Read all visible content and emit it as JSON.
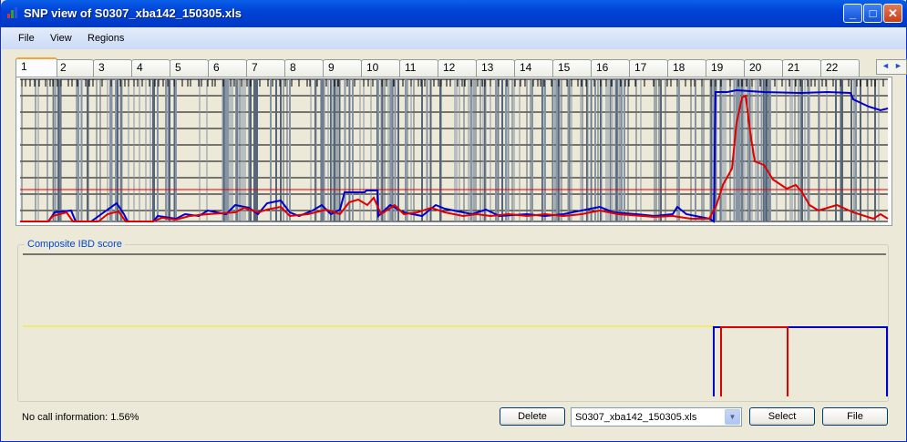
{
  "window": {
    "title": "SNP view of S0307_xba142_150305.xls",
    "controls": {
      "minimize": "_",
      "maximize": "□",
      "close": "✕"
    }
  },
  "menu": {
    "items": [
      "File",
      "View",
      "Regions"
    ]
  },
  "tabs": {
    "items": [
      "1",
      "2",
      "3",
      "4",
      "5",
      "6",
      "7",
      "8",
      "9",
      "10",
      "11",
      "12",
      "13",
      "14",
      "15",
      "16",
      "17",
      "18",
      "19",
      "20",
      "21",
      "22"
    ],
    "active": "1",
    "scroll_left": "◄",
    "scroll_right": "►"
  },
  "ibd": {
    "legend": "Composite IBD score"
  },
  "status": {
    "no_call": "No call information: 1.56%"
  },
  "footer": {
    "delete_label": "Delete",
    "file_select_value": "S0307_xba142_150305.xls",
    "select_label": "Select",
    "file_label": "File"
  },
  "colors": {
    "blue_series": "#0000CC",
    "red_series": "#E00000",
    "snp_lines": "#6E7E8E",
    "threshold": "#E00000",
    "yellow_line": "#F0F000"
  }
}
